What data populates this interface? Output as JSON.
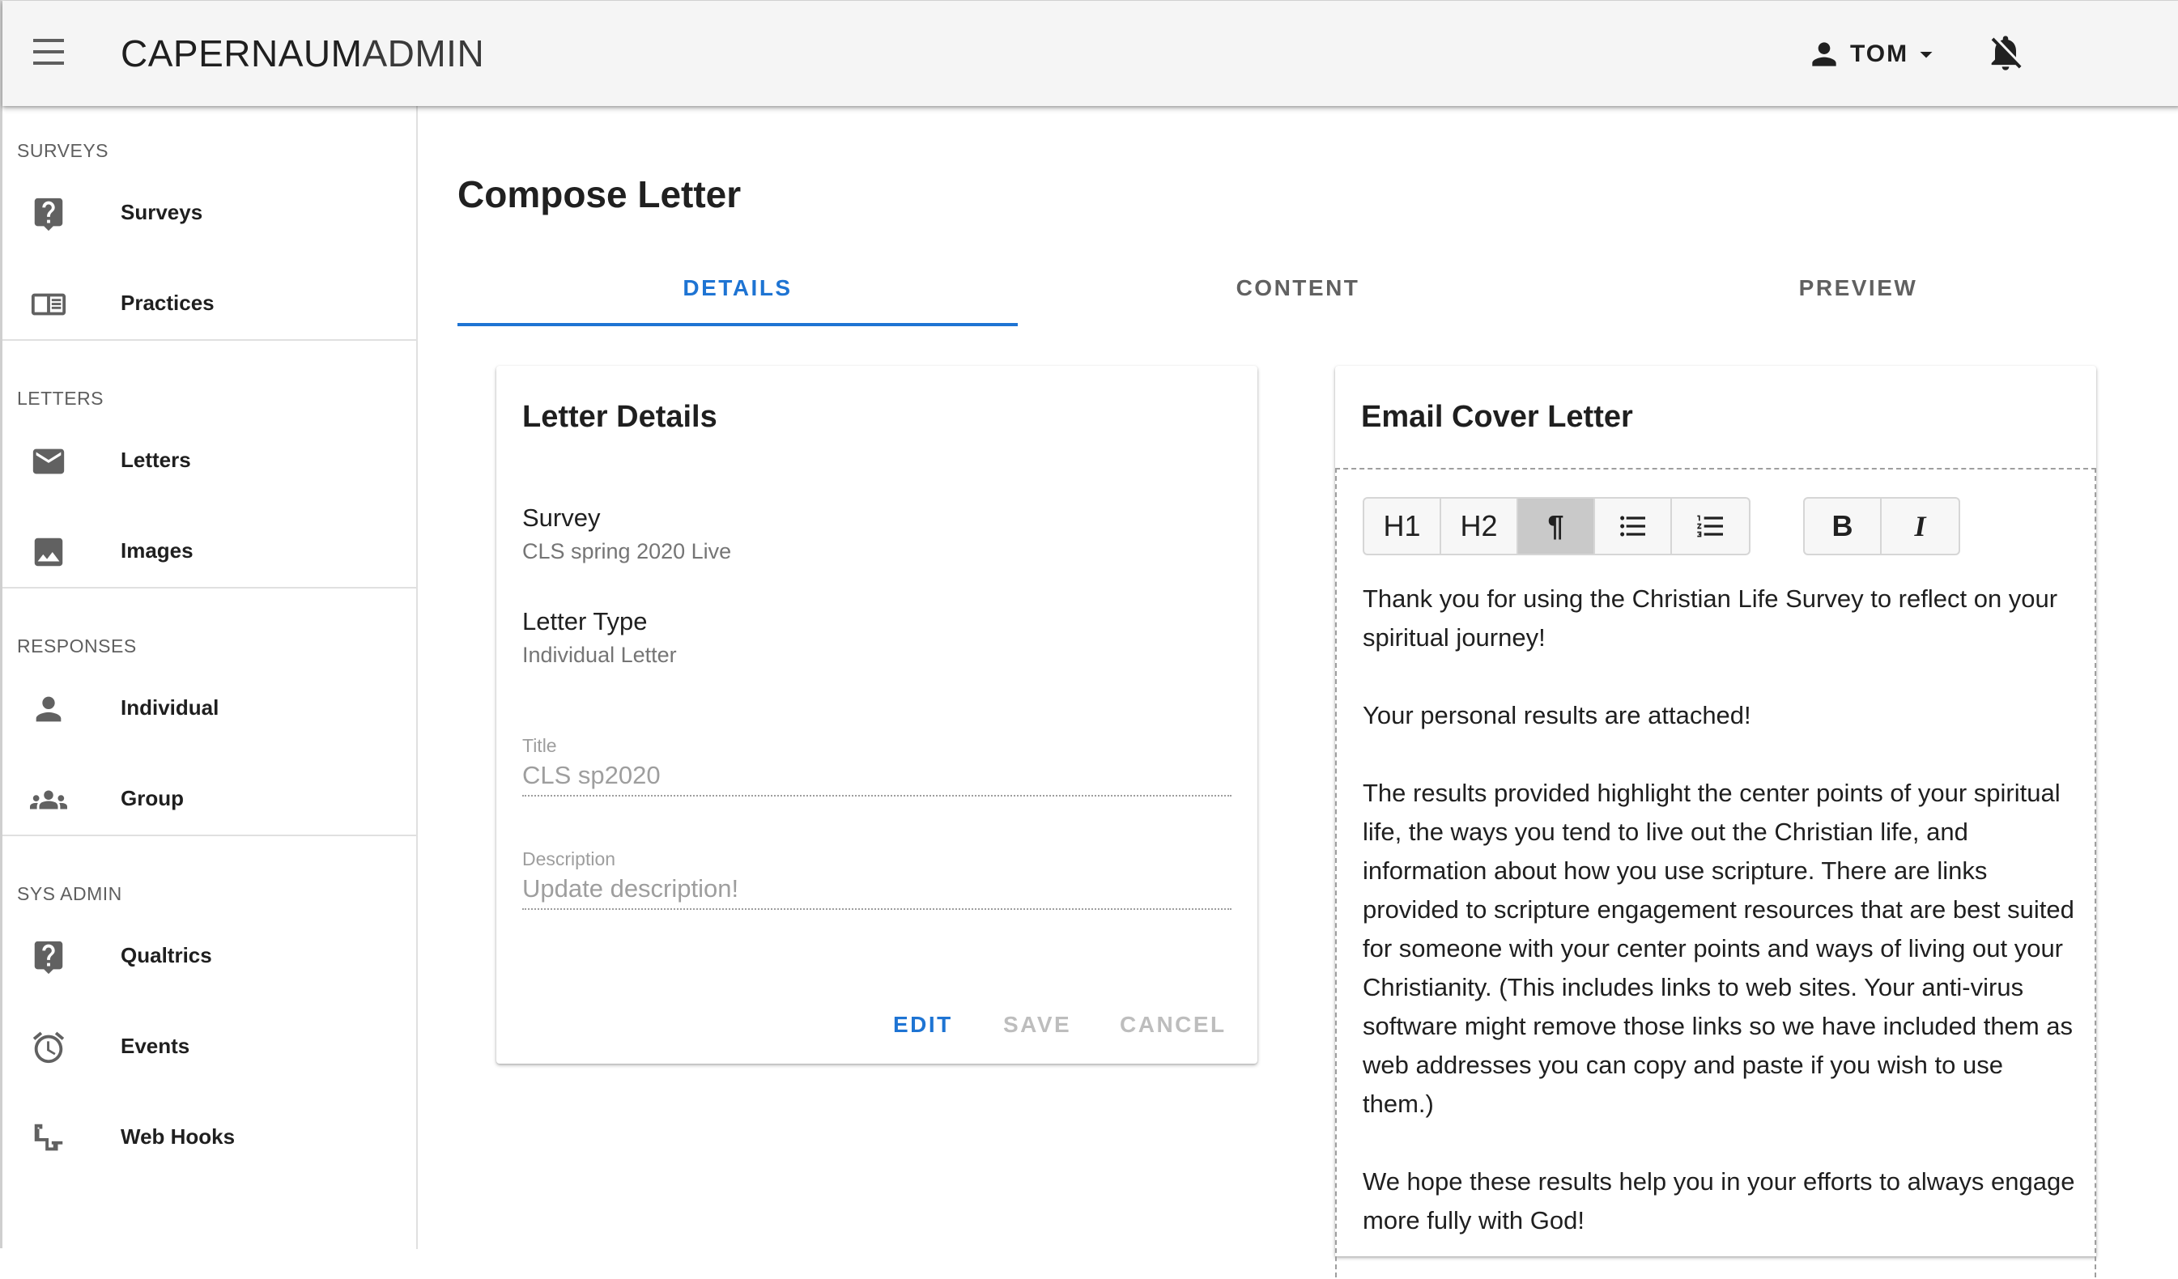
{
  "app": {
    "title_bold": "CAPERNAUM",
    "title_light": "ADMIN",
    "user": "TOM"
  },
  "sidebar": {
    "sections": [
      {
        "header": "SURVEYS",
        "items": [
          {
            "label": "Surveys",
            "icon": "survey-icon"
          },
          {
            "label": "Practices",
            "icon": "practices-icon"
          }
        ]
      },
      {
        "header": "LETTERS",
        "items": [
          {
            "label": "Letters",
            "icon": "mail-icon"
          },
          {
            "label": "Images",
            "icon": "image-icon"
          }
        ]
      },
      {
        "header": "RESPONSES",
        "items": [
          {
            "label": "Individual",
            "icon": "person-icon"
          },
          {
            "label": "Group",
            "icon": "group-icon"
          }
        ]
      },
      {
        "header": "SYS ADMIN",
        "items": [
          {
            "label": "Qualtrics",
            "icon": "qualtrics-icon"
          },
          {
            "label": "Events",
            "icon": "alarm-icon"
          },
          {
            "label": "Web Hooks",
            "icon": "webhook-icon"
          }
        ]
      }
    ]
  },
  "main": {
    "page_title": "Compose Letter",
    "tabs": [
      {
        "label": "DETAILS",
        "active": true
      },
      {
        "label": "CONTENT",
        "active": false
      },
      {
        "label": "PREVIEW",
        "active": false
      }
    ]
  },
  "details_card": {
    "title": "Letter Details",
    "survey_label": "Survey",
    "survey_value": "CLS spring 2020 Live",
    "type_label": "Letter Type",
    "type_value": "Individual Letter",
    "title_field_label": "Title",
    "title_field_value": "CLS sp2020",
    "description_field_label": "Description",
    "description_field_value": "Update description!",
    "actions": {
      "edit": "EDIT",
      "save": "SAVE",
      "cancel": "CANCEL"
    }
  },
  "cover_card": {
    "title": "Email Cover Letter",
    "toolbar": {
      "h1": "H1",
      "h2": "H2",
      "paragraph": "¶",
      "bold": "B",
      "italic": "I"
    },
    "paragraphs": [
      "Thank you for using the Christian Life Survey to reflect on your spiritual journey!",
      "Your personal results are attached!",
      "The results provided highlight the center points of your spiritual life, the ways you tend to live out the Christian life, and information about how you use scripture. There are links provided to scripture engagement resources that are best suited for someone with your center points and ways of living out your Christianity. (This includes links to web sites. Your anti-virus software might remove those links so we have included them as web addresses you can copy and paste if you wish to use them.)",
      "We hope these results help you in your efforts to always engage more fully with God!"
    ]
  },
  "colors": {
    "accent": "#1e74d3",
    "appbar_bg": "#f5f5f5",
    "muted_text": "#9e9e9e"
  }
}
